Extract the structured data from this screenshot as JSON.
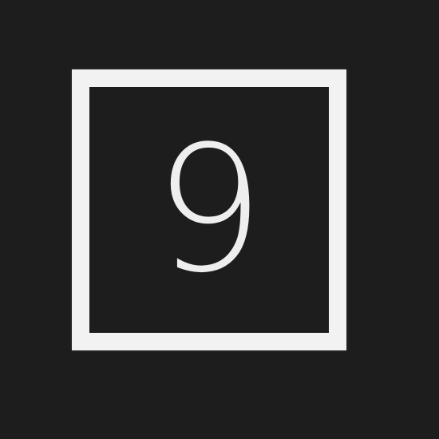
{
  "badge": {
    "value": "9",
    "border_color": "#f2f2f2",
    "text_color": "#eeeeee",
    "background_color": "#1d1d1d"
  }
}
